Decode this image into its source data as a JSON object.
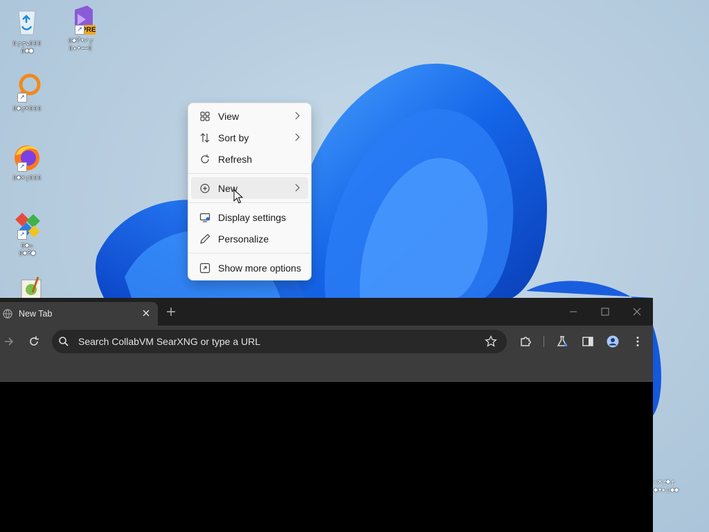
{
  "desktop": {
    "icons": [
      {
        "name": "recycle-bin",
        "caption": "▯┌┌↘▯▯▯\n▯◆●"
      },
      {
        "name": "visual-studio-preview",
        "badge": "PRE",
        "caption": "▯◆?▾✓┌\n▯▴▾⎯⎯▯"
      },
      {
        "name": "search-app",
        "caption": "▯◆┌✕▯▯▯"
      },
      {
        "name": "firefox",
        "caption": "▯◆✕┌▯▯▯"
      },
      {
        "name": "control-panel",
        "caption": "▯◆▵\n▯◆?●"
      },
      {
        "name": "notepad-plus-plus",
        "caption": ""
      }
    ],
    "corner_caption": "▵✕┌◆┌\n◆▾▸▯◆◆"
  },
  "context_menu": {
    "items": [
      {
        "label": "View",
        "icon": "grid-icon",
        "submenu": true
      },
      {
        "label": "Sort by",
        "icon": "sort-icon",
        "submenu": true
      },
      {
        "label": "Refresh",
        "icon": "refresh-icon",
        "submenu": false
      },
      {
        "label": "New",
        "icon": "plus-circle-icon",
        "submenu": true,
        "hovered": true
      },
      {
        "label": "Display settings",
        "icon": "display-icon",
        "submenu": false
      },
      {
        "label": "Personalize",
        "icon": "pen-icon",
        "submenu": false
      },
      {
        "label": "Show more options",
        "icon": "expand-icon",
        "submenu": false
      }
    ]
  },
  "browser": {
    "tab_title": "New Tab",
    "omnibox_placeholder": "Search CollabVM SearXNG or type a URL"
  },
  "colors": {
    "accent": "#1a6cf0",
    "browser_bg": "#3c3c3c",
    "menu_bg": "#f9f9f9"
  }
}
